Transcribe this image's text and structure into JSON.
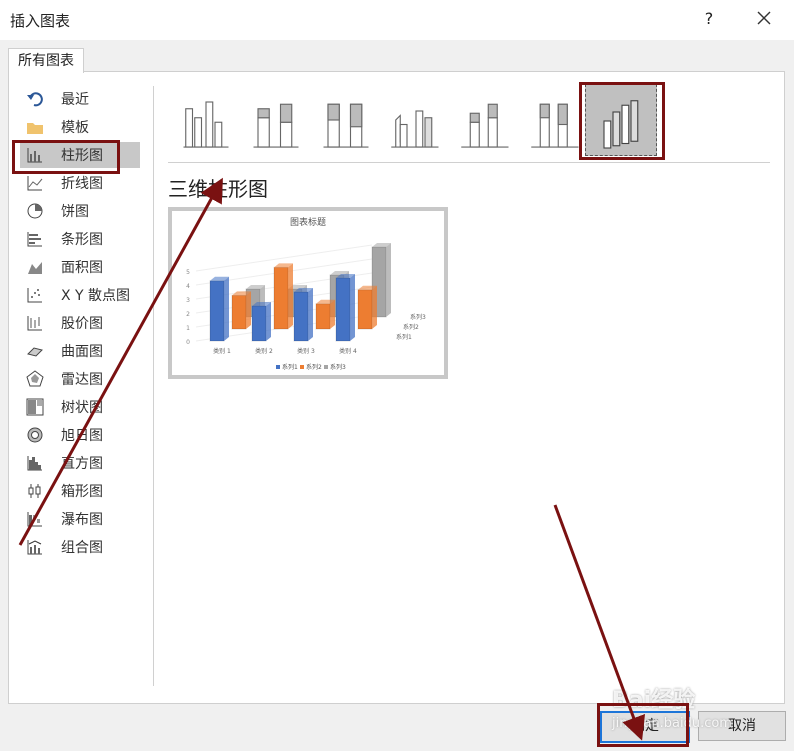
{
  "dialog": {
    "title": "插入图表",
    "help": "?"
  },
  "tab": {
    "label": "所有图表"
  },
  "sidebar": {
    "items": [
      {
        "label": "最近",
        "icon": "undo-icon"
      },
      {
        "label": "模板",
        "icon": "folder-icon"
      },
      {
        "label": "柱形图",
        "icon": "column-chart-icon",
        "selected": true
      },
      {
        "label": "折线图",
        "icon": "line-chart-icon"
      },
      {
        "label": "饼图",
        "icon": "pie-chart-icon"
      },
      {
        "label": "条形图",
        "icon": "bar-chart-icon"
      },
      {
        "label": "面积图",
        "icon": "area-chart-icon"
      },
      {
        "label": "X Y 散点图",
        "icon": "scatter-chart-icon"
      },
      {
        "label": "股价图",
        "icon": "stock-chart-icon"
      },
      {
        "label": "曲面图",
        "icon": "surface-chart-icon"
      },
      {
        "label": "雷达图",
        "icon": "radar-chart-icon"
      },
      {
        "label": "树状图",
        "icon": "treemap-icon"
      },
      {
        "label": "旭日图",
        "icon": "sunburst-icon"
      },
      {
        "label": "直方图",
        "icon": "histogram-icon"
      },
      {
        "label": "箱形图",
        "icon": "box-whisker-icon"
      },
      {
        "label": "瀑布图",
        "icon": "waterfall-icon"
      },
      {
        "label": "组合图",
        "icon": "combo-chart-icon"
      }
    ]
  },
  "subtypes": {
    "count": 7,
    "selected_index": 7,
    "heading": "三维柱形图"
  },
  "preview": {
    "title": "图表标题",
    "chart_data": {
      "type": "bar",
      "title": "图表标题",
      "categories": [
        "类别 1",
        "类别 2",
        "类别 3",
        "类别 4"
      ],
      "series": [
        {
          "name": "系列1",
          "values": [
            4.3,
            2.5,
            3.5,
            4.5
          ],
          "color": "#4472c4"
        },
        {
          "name": "系列2",
          "values": [
            2.4,
            4.4,
            1.8,
            2.8
          ],
          "color": "#ed7d31"
        },
        {
          "name": "系列3",
          "values": [
            2.0,
            2.0,
            3.0,
            5.0
          ],
          "color": "#a5a5a5"
        }
      ],
      "yticks": [
        "0",
        "1",
        "2",
        "3",
        "4",
        "5"
      ],
      "depth_labels": [
        "系列3",
        "系列2",
        "系列1"
      ],
      "legend": "bottom"
    }
  },
  "buttons": {
    "ok": "确定",
    "cancel": "取消"
  },
  "watermark": {
    "brand": "Bai经验",
    "site": "jingyan.baidu.com"
  }
}
